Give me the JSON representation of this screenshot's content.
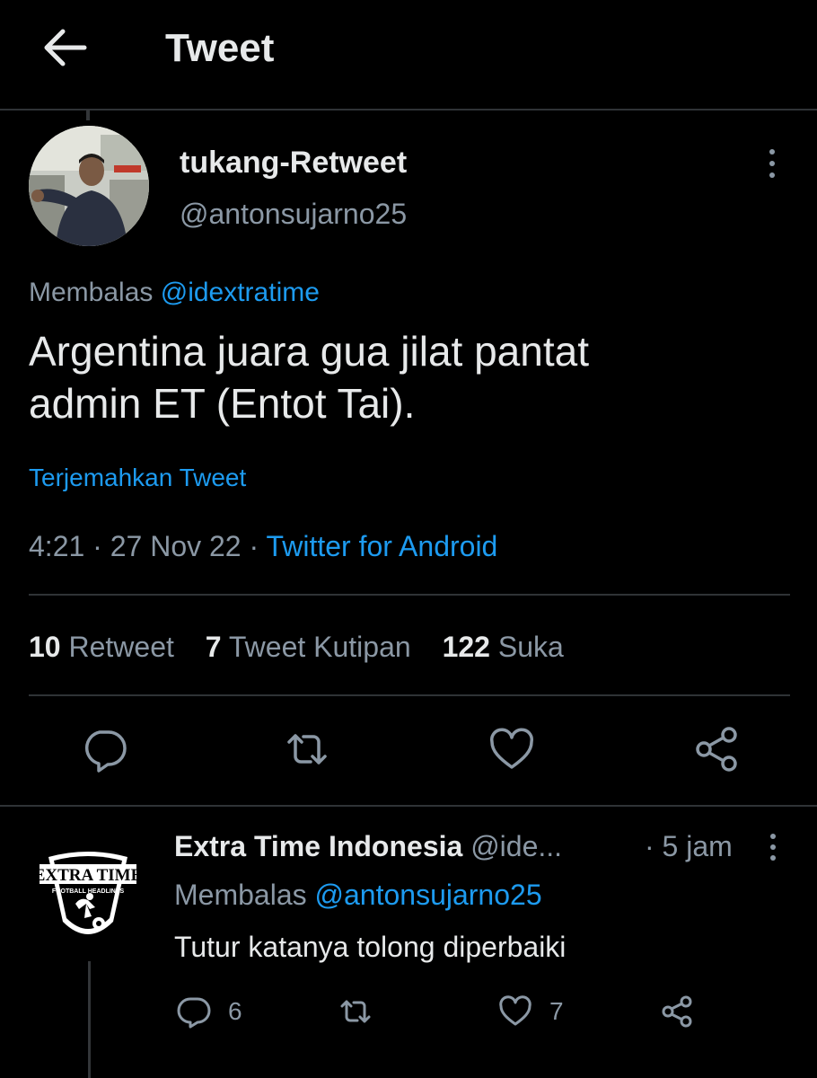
{
  "header": {
    "title": "Tweet"
  },
  "tweet": {
    "display_name": "tukang-Retweet",
    "handle": "@antonsujarno25",
    "reply_prefix": "Membalas",
    "reply_to": "@idextratime",
    "text_lines": [
      "Argentina juara gua jilat pantat",
      "admin ET (Entot Tai)."
    ],
    "translate_label": "Terjemahkan Tweet",
    "time": "4:21",
    "date": "27 Nov 22",
    "separator": "·",
    "source": "Twitter for Android",
    "stats": {
      "retweets": "10",
      "retweets_label": "Retweet",
      "quotes": "7",
      "quotes_label": "Tweet Kutipan",
      "likes": "122",
      "likes_label": "Suka"
    },
    "actions": [
      "reply-icon",
      "retweet-icon",
      "like-icon",
      "share-icon"
    ]
  },
  "reply": {
    "display_name": "Extra Time Indonesia",
    "handle": "@ide...",
    "time": "· 5 jam",
    "reply_prefix": "Membalas",
    "reply_to": "@antonsujarno25",
    "text": "Tutur katanya tolong diperbaiki",
    "counts": {
      "replies": "6",
      "likes": "7"
    },
    "logo": {
      "line1": "EXTRA TIME",
      "line2": "FOOTBALL HEADLINES"
    }
  },
  "colors": {
    "background": "#000000",
    "text": "#e7e9ea",
    "secondary": "#8b98a5",
    "accent": "#1d9bf0",
    "divider": "#2f3336"
  }
}
